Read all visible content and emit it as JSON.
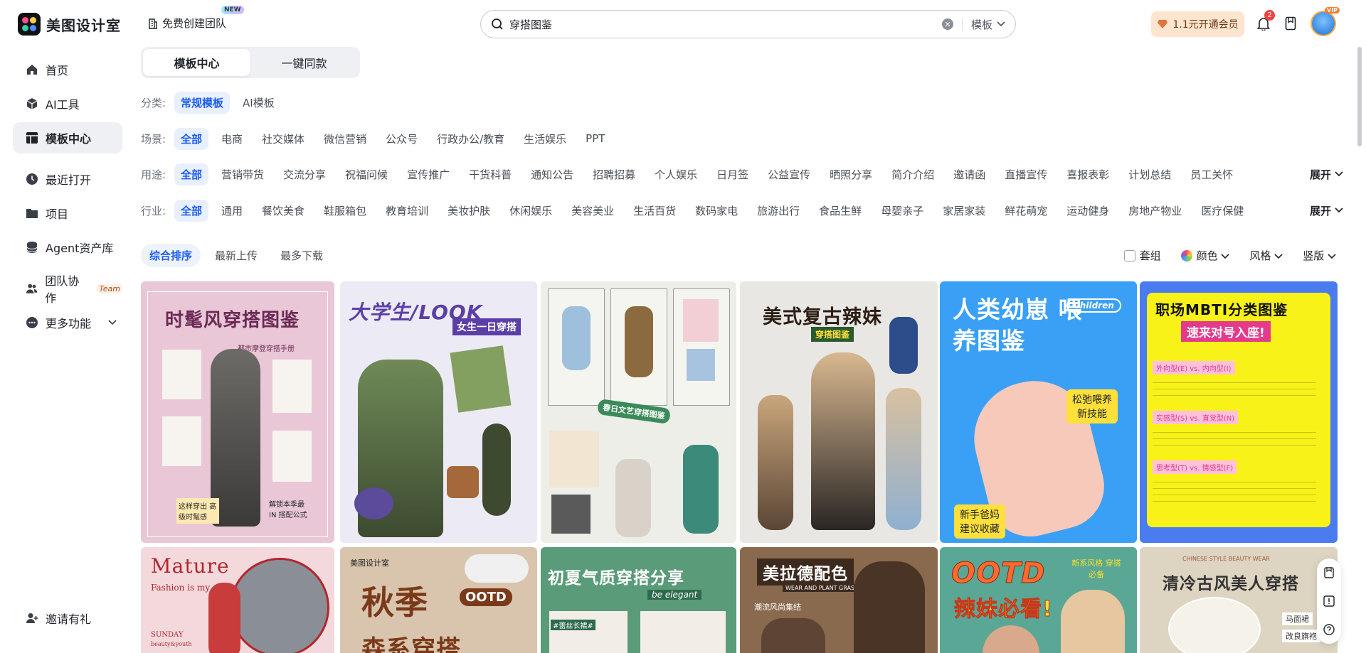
{
  "app": {
    "name": "美图设计室"
  },
  "header": {
    "team_button": "免费创建团队",
    "team_new_badge": "NEW",
    "search_value": "穿搭图鉴",
    "search_scope": "模板",
    "vip_button": "1.1元开通会员",
    "notification_count": "2",
    "avatar_badge": "VIP"
  },
  "sidebar": {
    "items": [
      {
        "label": "首页",
        "icon": "home-icon"
      },
      {
        "label": "AI工具",
        "icon": "ai-tools-icon"
      },
      {
        "label": "模板中心",
        "icon": "template-icon",
        "active": true
      },
      {
        "label": "最近打开",
        "icon": "clock-icon"
      },
      {
        "label": "项目",
        "icon": "folder-icon"
      },
      {
        "label": "Agent资产库",
        "icon": "database-icon"
      },
      {
        "label": "团队协作",
        "icon": "team-icon",
        "tag": "Team"
      },
      {
        "label": "更多功能",
        "icon": "more-icon"
      }
    ],
    "invite": "邀请有礼"
  },
  "main": {
    "tabs": [
      "模板中心",
      "一键同款"
    ],
    "category": {
      "label": "分类:",
      "items": [
        "常规模板",
        "AI模板"
      ]
    },
    "scene": {
      "label": "场景:",
      "items": [
        "全部",
        "电商",
        "社交媒体",
        "微信营销",
        "公众号",
        "行政办公/教育",
        "生活娱乐",
        "PPT"
      ]
    },
    "usage": {
      "label": "用途:",
      "items": [
        "全部",
        "营销带货",
        "交流分享",
        "祝福问候",
        "宣传推广",
        "干货科普",
        "通知公告",
        "招聘招募",
        "个人娱乐",
        "日月签",
        "公益宣传",
        "晒照分享",
        "简介介绍",
        "邀请函",
        "直播宣传",
        "喜报表彰",
        "计划总结",
        "员工关怀"
      ]
    },
    "industry": {
      "label": "行业:",
      "items": [
        "全部",
        "通用",
        "餐饮美食",
        "鞋服箱包",
        "教育培训",
        "美妆护肤",
        "休闲娱乐",
        "美容美业",
        "生活百货",
        "数码家电",
        "旅游出行",
        "食品生鲜",
        "母婴亲子",
        "家居家装",
        "鲜花萌宠",
        "运动健身",
        "房地产物业",
        "医疗保健"
      ]
    },
    "expand_label": "展开",
    "sort": [
      "综合排序",
      "最新上传",
      "最多下载"
    ],
    "right_filters": {
      "set": "套组",
      "color": "颜色",
      "style": "风格",
      "orientation": "竖版"
    }
  },
  "templates": {
    "row1": [
      {
        "title": "时髦风穿搭图鉴",
        "sub1": "都市摩登穿搭手册",
        "sub2": "这样穿出 高级时髦感",
        "sub3": "解锁本季最IN 搭配公式",
        "bg": "#e9c7d6",
        "accent": "#6b2a55"
      },
      {
        "title": "大学生/LOOK",
        "sub1": "女生一日穿搭",
        "bg": "#ecebf5",
        "accent": "#5b3fa6"
      },
      {
        "title": "春日文艺穿搭图鉴",
        "bg": "#eeeee9",
        "accent": "#3a8a5a"
      },
      {
        "title": "美式复古辣妹",
        "sub1": "穿搭图鉴",
        "bg": "#e9e7e3",
        "accent": "#2a1d14"
      },
      {
        "title": "人类幼崽 喂养图鉴",
        "sub1": "Children",
        "sub2": "松弛喂养 新技能",
        "sub3": "新手爸妈 建议收藏",
        "bg": "#3aa0f5",
        "accent": "#ffe03a"
      },
      {
        "title": "职场MBTI分类图鉴",
        "sub1": "速来对号入座!",
        "sub2": "外向型(E) vs. 内向型(I)",
        "sub3": "实感型(S) vs. 直觉型(N)",
        "sub4": "思考型(T) vs. 情感型(F)",
        "bg": "#4a7cf0",
        "accent": "#f8f218"
      }
    ],
    "row2": [
      {
        "title": "Mature",
        "sub1": "Fashion is my attitude",
        "sub2": "SUNDAY",
        "sub3": "beauty&youth",
        "bg": "#f3d9dc",
        "accent": "#b3262c"
      },
      {
        "title": "秋季",
        "sub1": "OOTD",
        "sub2": "森系穿搭",
        "sub3": "美图设计室",
        "bg": "#d9c4ad",
        "accent": "#7a3a1a"
      },
      {
        "title": "初夏气质穿搭分享",
        "sub1": "be elegant",
        "sub2": "#蕾丝长裙#",
        "bg": "#5a9b7a",
        "accent": "#ffffff"
      },
      {
        "title": "美拉德配色",
        "sub1": "WEAR AND PLANT GRASS",
        "sub2": "潮流风尚集结",
        "bg": "#8a6a4e",
        "accent": "#ffffff"
      },
      {
        "title": "OOTD",
        "sub1": "辣妹必看!",
        "sub2": "新系风格 穿搭必备",
        "bg": "#5aa796",
        "accent": "#f5e02a"
      },
      {
        "title": "清冷古风美人穿搭",
        "sub1": "CHINESE STYLE BEAUTY WEAR",
        "sub2": "马面裙",
        "sub3": "改良旗袍",
        "bg": "#ddd4c2",
        "accent": "#333333"
      }
    ]
  }
}
